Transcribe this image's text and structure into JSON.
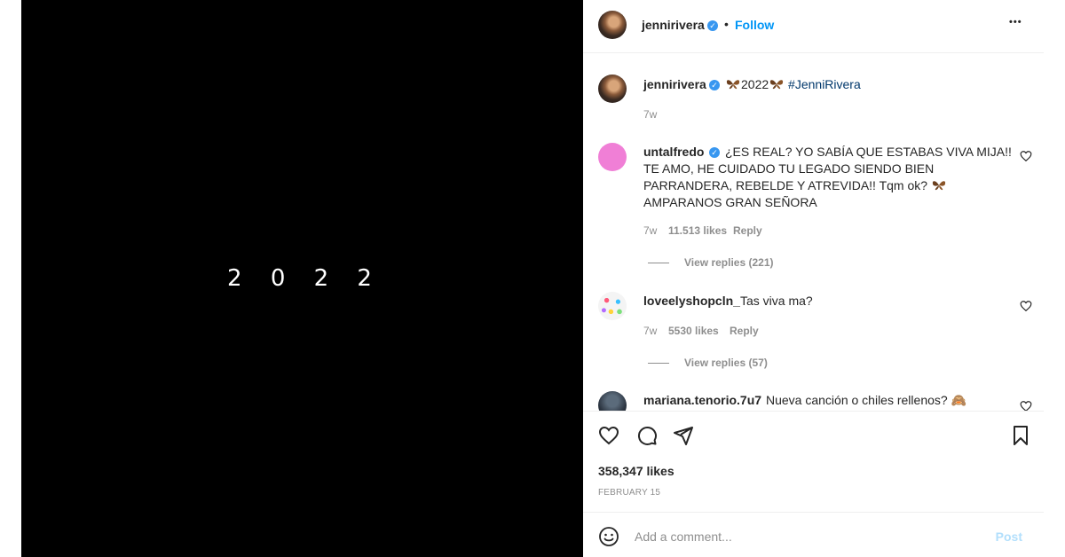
{
  "media": {
    "text": "2 0 2 2"
  },
  "header": {
    "username": "jennirivera",
    "separator": "•",
    "follow_label": "Follow",
    "more_label": "•••"
  },
  "caption": {
    "username": "jennirivera",
    "text_pre": "",
    "text_mid": "2022",
    "hashtag": "#JenniRivera",
    "time": "7w"
  },
  "comments": [
    {
      "username": "untalfredo",
      "verified": true,
      "text_lines": [
        "¿ES REAL? YO SABÍA QUE ESTABAS VIVA MIJA!!",
        "TE AMO, HE CUIDADO TU LEGADO SIENDO BIEN",
        "PARRANDERA, REBELDE Y ATREVIDA!! Tqm ok?",
        "AMPARANOS GRAN SEÑORA"
      ],
      "time": "7w",
      "likes": "11.513 likes",
      "reply": "Reply",
      "view_replies": "View replies (221)"
    },
    {
      "username": "loveelyshopcln_",
      "verified": false,
      "text": "Tas viva ma?",
      "time": "7w",
      "likes": "5530 likes",
      "reply": "Reply",
      "view_replies": "View replies (57)"
    },
    {
      "username": "mariana.tenorio.7u7",
      "verified": false,
      "text": "Nueva canción o chiles rellenos?",
      "emoji": "🙈"
    }
  ],
  "actions": {
    "likes": "358,347 likes",
    "date": "FEBRUARY 15"
  },
  "add_comment": {
    "placeholder": "Add a comment...",
    "post_label": "Post"
  },
  "colors": {
    "accent": "#0095f6",
    "verified": "#3897f0",
    "hashtag": "#00376b",
    "muted": "#8e8e8e",
    "post_disabled": "#b2dffc"
  },
  "icons": [
    "verified-badge-icon",
    "more-options-icon",
    "butterfly-emoji-icon",
    "heart-icon",
    "comment-icon",
    "share-icon",
    "bookmark-icon",
    "emoji-icon"
  ]
}
